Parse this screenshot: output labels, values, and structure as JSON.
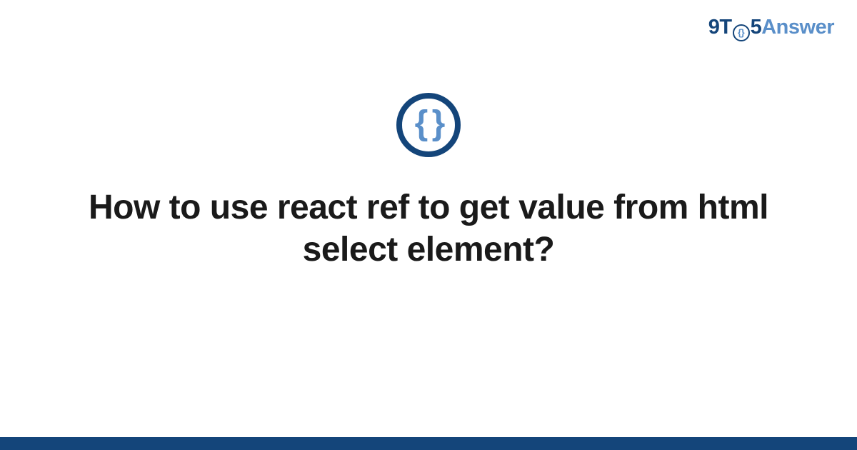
{
  "logo": {
    "part1": "9T",
    "circle_inner": "{}",
    "part2": "5",
    "part3": "Answer"
  },
  "icon": {
    "braces": "{ }"
  },
  "question_title": "How to use react ref to get value from html select element?",
  "colors": {
    "dark_blue": "#14457a",
    "light_blue": "#5a8fc9"
  }
}
